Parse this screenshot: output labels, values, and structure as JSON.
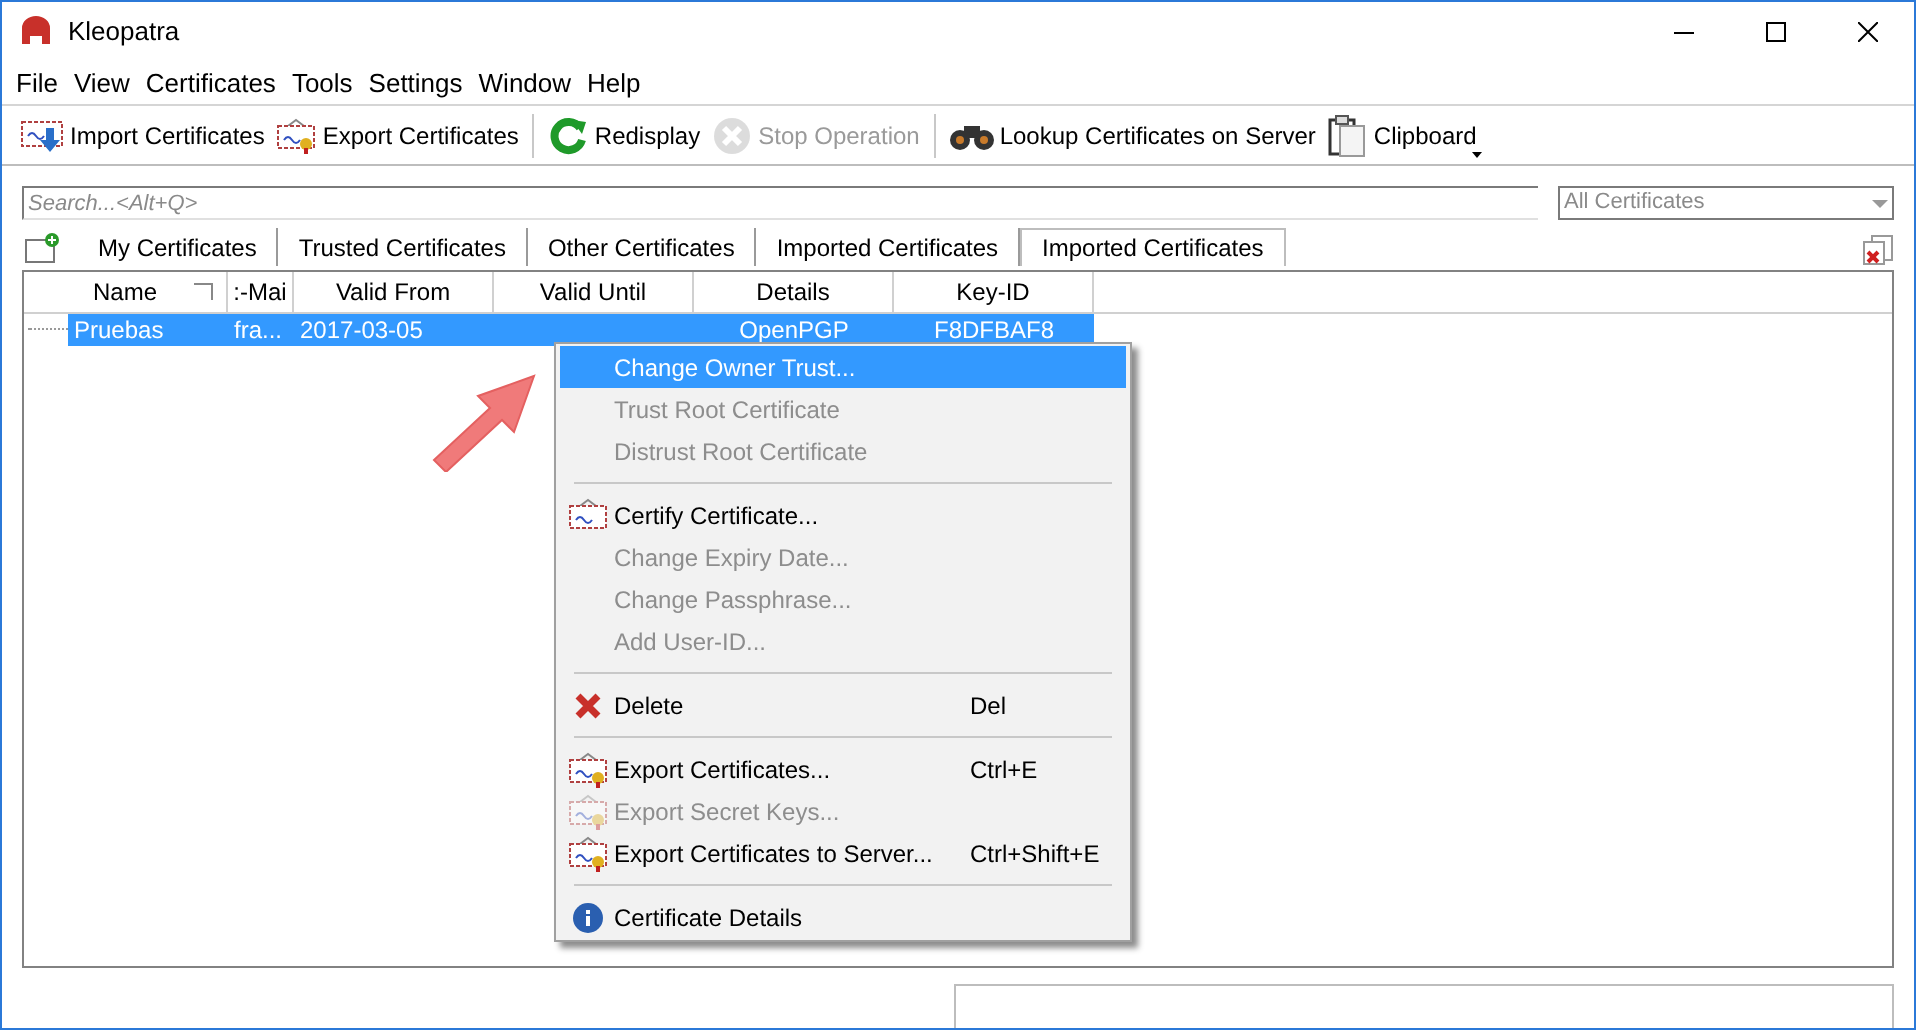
{
  "window": {
    "title": "Kleopatra"
  },
  "menubar": [
    "File",
    "View",
    "Certificates",
    "Tools",
    "Settings",
    "Window",
    "Help"
  ],
  "toolbar": [
    {
      "kind": "import",
      "label": "Import Certificates",
      "disabled": false
    },
    {
      "kind": "export",
      "label": "Export Certificates",
      "disabled": false
    },
    {
      "kind": "redisplay",
      "label": "Redisplay",
      "disabled": false
    },
    {
      "kind": "stop",
      "label": "Stop Operation",
      "disabled": true
    },
    {
      "kind": "lookup",
      "label": "Lookup Certificates on Server",
      "disabled": false
    },
    {
      "kind": "clipboard",
      "label": "Clipboard",
      "disabled": false
    }
  ],
  "search": {
    "placeholder": "Search...<Alt+Q>"
  },
  "filter": {
    "value": "All Certificates"
  },
  "tabs": [
    {
      "label": "My Certificates",
      "selected": false
    },
    {
      "label": "Trusted Certificates",
      "selected": false
    },
    {
      "label": "Other Certificates",
      "selected": false
    },
    {
      "label": "Imported Certificates",
      "selected": false
    },
    {
      "label": "Imported Certificates",
      "selected": true
    }
  ],
  "table": {
    "columns": [
      "Name",
      ":-Mai",
      "Valid From",
      "Valid Until",
      "Details",
      "Key-ID"
    ],
    "rows": [
      {
        "selected": true,
        "cells": [
          "Pruebas",
          "fra...",
          "2017-03-05",
          "",
          "OpenPGP",
          "F8DFBAF8"
        ]
      }
    ]
  },
  "context_menu": [
    {
      "kind": "plain",
      "label": "Change Owner Trust...",
      "disabled": false,
      "selected": true
    },
    {
      "kind": "plain",
      "label": "Trust Root Certificate",
      "disabled": true,
      "selected": false
    },
    {
      "kind": "plain",
      "label": "Distrust Root Certificate",
      "disabled": true,
      "selected": false
    },
    {
      "kind": "separator"
    },
    {
      "kind": "certify",
      "label": "Certify Certificate...",
      "disabled": false,
      "selected": false
    },
    {
      "kind": "plain",
      "label": "Change Expiry Date...",
      "disabled": true,
      "selected": false
    },
    {
      "kind": "plain",
      "label": "Change Passphrase...",
      "disabled": true,
      "selected": false
    },
    {
      "kind": "plain",
      "label": "Add User-ID...",
      "disabled": true,
      "selected": false
    },
    {
      "kind": "separator"
    },
    {
      "kind": "delete",
      "label": "Delete",
      "shortcut": "Del",
      "disabled": false,
      "selected": false
    },
    {
      "kind": "separator"
    },
    {
      "kind": "export",
      "label": "Export Certificates...",
      "shortcut": "Ctrl+E",
      "disabled": false,
      "selected": false
    },
    {
      "kind": "export",
      "label": "Export Secret Keys...",
      "disabled": true,
      "selected": false
    },
    {
      "kind": "export",
      "label": "Export Certificates to Server...",
      "shortcut": "Ctrl+Shift+E",
      "disabled": false,
      "selected": false
    },
    {
      "kind": "separator"
    },
    {
      "kind": "info",
      "label": "Certificate Details",
      "disabled": false,
      "selected": false
    }
  ]
}
